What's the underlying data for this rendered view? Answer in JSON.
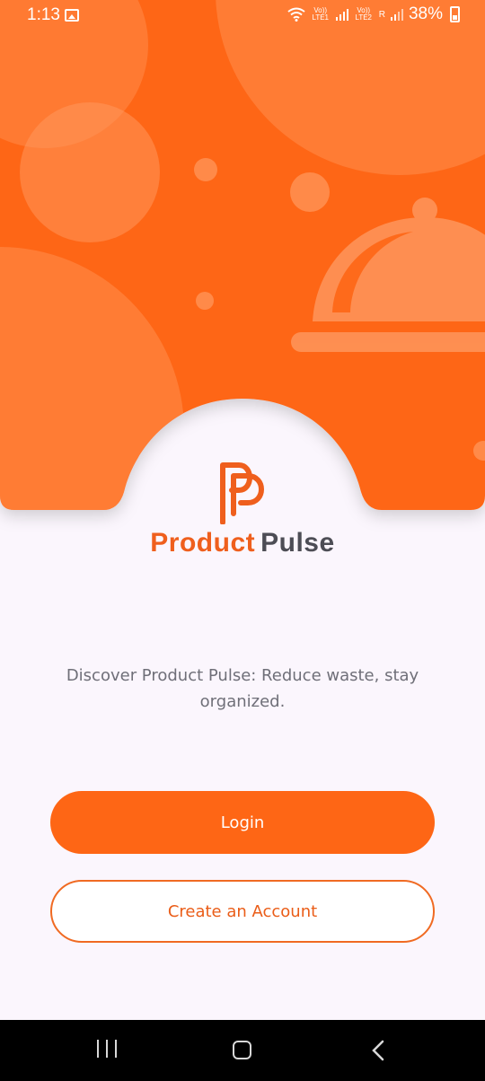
{
  "status_bar": {
    "time": "1:13",
    "net1": "Vo)) LTE1",
    "net2": "Vo)) LTE2",
    "roaming": "R",
    "battery": "38%"
  },
  "brand": {
    "part1": "Product",
    "part2": "Pulse"
  },
  "tagline": "Discover Product Pulse: Reduce waste, stay organized.",
  "buttons": {
    "login": "Login",
    "create_account": "Create an Account"
  },
  "colors": {
    "accent": "#fe6615",
    "text_gray": "#6f6f78",
    "background": "#fbf6fd"
  },
  "icons": [
    "gallery-icon",
    "wifi-icon",
    "signal-icon",
    "battery-icon",
    "food-cloche-icon",
    "recents-icon",
    "home-icon",
    "back-icon"
  ]
}
